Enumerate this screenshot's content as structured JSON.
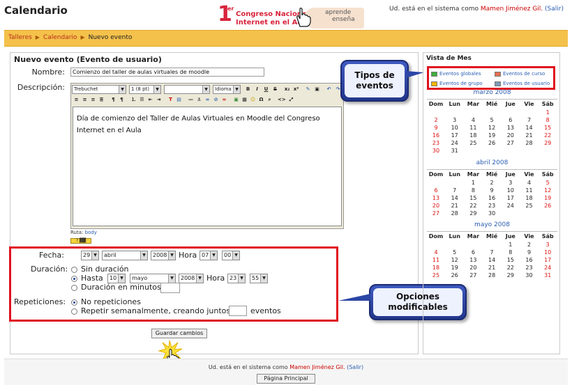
{
  "header": {
    "site_title": "Calendario",
    "logo": {
      "one": "1",
      "sup": "er",
      "line1": "Congreso Nacional",
      "line2": "Internet en el Aula",
      "tag1": "aprende",
      "tag2": "enseña"
    },
    "login_prefix": "Ud. está en el sistema como",
    "user": "Mamen Jiménez Gil.",
    "logout": "(Salir)"
  },
  "breadcrumb": {
    "items": [
      "Talleres",
      "Calendario"
    ],
    "current": "Nuevo evento"
  },
  "form": {
    "title": "Nuevo evento (Evento de usuario)",
    "name_label": "Nombre:",
    "name_value": "Comienzo del taller de aulas virtuales de moodle",
    "desc_label": "Descripción:",
    "font": "Trebuchet",
    "size": "1 (8 pt)",
    "lang": "Idioma",
    "description": "Día de comienzo del Taller de Aulas Virtuales en Moodle del Congreso Internet en el Aula",
    "path_label": "Ruta:",
    "path_value": "body",
    "fecha_label": "Fecha:",
    "fecha": {
      "day": "29",
      "month": "abril",
      "year": "2008",
      "hour_label": "Hora",
      "hour": "07",
      "min": "00"
    },
    "duracion_label": "Duración:",
    "sin_duracion": "Sin duración",
    "hasta": "Hasta",
    "hasta_values": {
      "day": "10",
      "month": "mayo",
      "year": "2008",
      "hour_label": "Hora",
      "hour": "23",
      "min": "55"
    },
    "duracion_minutos": "Duración en minutos",
    "repeticiones_label": "Repeticiones:",
    "no_repeticiones": "No repeticiones",
    "repetir": "Repetir semanalmente, creando juntos",
    "eventos": "eventos",
    "save": "Guardar cambios"
  },
  "callouts": {
    "tipos": "Tipos de eventos",
    "opciones": "Opciones modificables"
  },
  "sidebar": {
    "title": "Vista de Mes",
    "legend": [
      {
        "label": "Eventos globales",
        "color": "#3fae3a"
      },
      {
        "label": "Eventos de curso",
        "color": "#e76f51"
      },
      {
        "label": "Eventos de grupo",
        "color": "#f4b400"
      },
      {
        "label": "Eventos de usuario",
        "color": "#7e9bb8"
      }
    ],
    "day_headers": [
      "Dom",
      "Lun",
      "Mar",
      "Mié",
      "Jue",
      "Vie",
      "Sáb"
    ],
    "months": [
      {
        "title": "marzo 2008",
        "weeks": [
          [
            "",
            "",
            "",
            "",
            "",
            "",
            "1"
          ],
          [
            "2",
            "3",
            "4",
            "5",
            "6",
            "7",
            "8"
          ],
          [
            "9",
            "10",
            "11",
            "12",
            "13",
            "14",
            "15"
          ],
          [
            "16",
            "17",
            "18",
            "19",
            "20",
            "21",
            "22"
          ],
          [
            "23",
            "24",
            "25",
            "26",
            "27",
            "28",
            "29"
          ],
          [
            "30",
            "31",
            "",
            "",
            "",
            "",
            ""
          ]
        ]
      },
      {
        "title": "abril 2008",
        "weeks": [
          [
            "",
            "",
            "1",
            "2",
            "3",
            "4",
            "5"
          ],
          [
            "6",
            "7",
            "8",
            "9",
            "10",
            "11",
            "12"
          ],
          [
            "13",
            "14",
            "15",
            "16",
            "17",
            "18",
            "19"
          ],
          [
            "20",
            "21",
            "22",
            "23",
            "24",
            "25",
            "26"
          ],
          [
            "27",
            "28",
            "29",
            "30",
            "",
            "",
            ""
          ]
        ]
      },
      {
        "title": "mayo 2008",
        "weeks": [
          [
            "",
            "",
            "",
            "",
            "1",
            "2",
            "3"
          ],
          [
            "4",
            "5",
            "6",
            "7",
            "8",
            "9",
            "10"
          ],
          [
            "11",
            "12",
            "13",
            "14",
            "15",
            "16",
            "17"
          ],
          [
            "18",
            "19",
            "20",
            "21",
            "22",
            "23",
            "24"
          ],
          [
            "25",
            "26",
            "27",
            "28",
            "29",
            "30",
            "31"
          ]
        ]
      }
    ]
  },
  "footer": {
    "login_prefix": "Ud. está en el sistema como",
    "user": "Mamen Jiménez Gil.",
    "logout": "(Salir)",
    "home": "Página Principal"
  }
}
